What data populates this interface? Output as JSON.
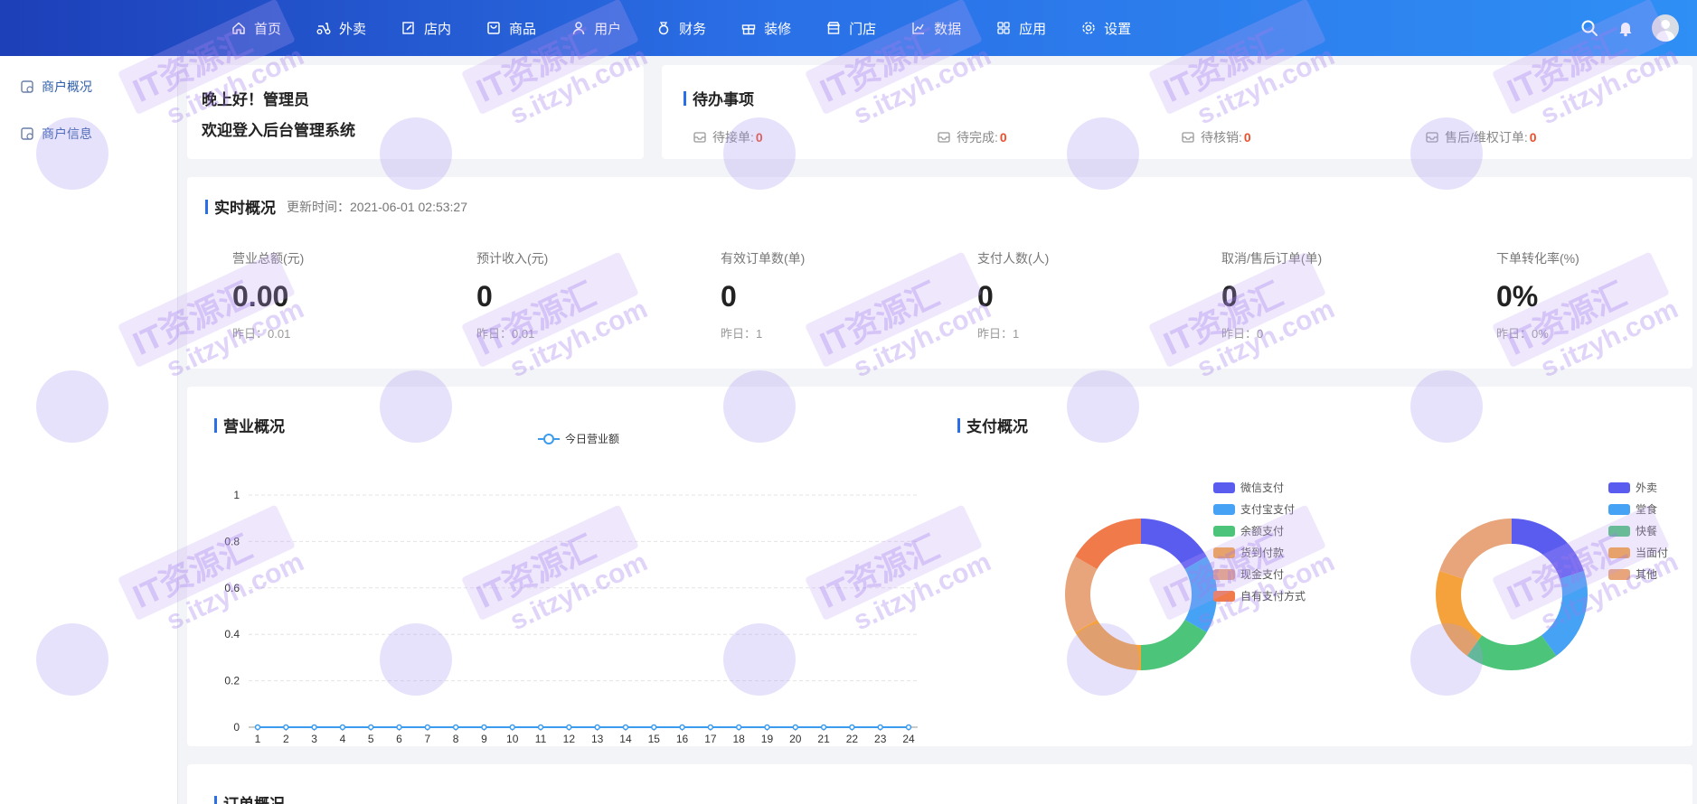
{
  "nav": [
    {
      "label": "首页",
      "icon": "home-icon"
    },
    {
      "label": "外卖",
      "icon": "scooter-icon"
    },
    {
      "label": "店内",
      "icon": "edit-icon"
    },
    {
      "label": "商品",
      "icon": "bag-icon"
    },
    {
      "label": "用户",
      "icon": "user-icon"
    },
    {
      "label": "财务",
      "icon": "money-bag-icon"
    },
    {
      "label": "装修",
      "icon": "gift-icon"
    },
    {
      "label": "门店",
      "icon": "store-icon"
    },
    {
      "label": "数据",
      "icon": "chart-icon"
    },
    {
      "label": "应用",
      "icon": "apps-icon"
    },
    {
      "label": "设置",
      "icon": "gear-icon"
    }
  ],
  "sidebar": {
    "items": [
      {
        "label": "商户概况",
        "icon": "overview-icon"
      },
      {
        "label": "商户信息",
        "icon": "info-icon"
      }
    ]
  },
  "welcome": {
    "line1": "晚上好！管理员",
    "line2": "欢迎登入后台管理系统"
  },
  "todo": {
    "title": "待办事项",
    "items": [
      {
        "label": "待接单:",
        "count": "0"
      },
      {
        "label": "待完成:",
        "count": "0"
      },
      {
        "label": "待核销:",
        "count": "0"
      },
      {
        "label": "售后/维权订单:",
        "count": "0"
      }
    ]
  },
  "realtime": {
    "title": "实时概况",
    "updated": "更新时间：2021-06-01 02:53:27",
    "metrics": [
      {
        "label": "营业总额(元)",
        "value": "0.00",
        "yesterday": "昨日：0.01"
      },
      {
        "label": "预计收入(元)",
        "value": "0",
        "yesterday": "昨日：0.01"
      },
      {
        "label": "有效订单数(单)",
        "value": "0",
        "yesterday": "昨日：1"
      },
      {
        "label": "支付人数(人)",
        "value": "0",
        "yesterday": "昨日：1"
      },
      {
        "label": "取消/售后订单(单)",
        "value": "0",
        "yesterday": "昨日：0"
      },
      {
        "label": "下单转化率(%)",
        "value": "0%",
        "yesterday": "昨日：0%"
      }
    ]
  },
  "business": {
    "title": "营业概况"
  },
  "payment": {
    "title": "支付概况"
  },
  "orders": {
    "title": "订单概况"
  },
  "watermark": {
    "brand": "IT资源汇",
    "domain": "s.itzyh.com"
  },
  "colors": {
    "accent": "#2a6fe6",
    "alert": "#ee4e2b"
  },
  "chart_data": [
    {
      "type": "line",
      "title": "营业概况",
      "series": [
        {
          "name": "今日营业额",
          "values": [
            0,
            0,
            0,
            0,
            0,
            0,
            0,
            0,
            0,
            0,
            0,
            0,
            0,
            0,
            0,
            0,
            0,
            0,
            0,
            0,
            0,
            0,
            0,
            0
          ]
        }
      ],
      "x": [
        1,
        2,
        3,
        4,
        5,
        6,
        7,
        8,
        9,
        10,
        11,
        12,
        13,
        14,
        15,
        16,
        17,
        18,
        19,
        20,
        21,
        22,
        23,
        24
      ],
      "yticks": [
        0,
        0.2,
        0.4,
        0.6,
        0.8,
        1
      ],
      "ylim": [
        0,
        1
      ],
      "grid": true,
      "legend": "top-center"
    },
    {
      "type": "pie",
      "style": "donut",
      "labels": [
        "微信支付",
        "支付宝支付",
        "余额支付",
        "货到付款",
        "现金支付",
        "自有支付方式"
      ],
      "values": [
        1,
        1,
        1,
        1,
        1,
        1
      ],
      "colors": [
        "#5a5cf0",
        "#45a2f5",
        "#4cc47a",
        "#f5a23c",
        "#e8a47a",
        "#f17a4a"
      ],
      "legend": "right"
    },
    {
      "type": "pie",
      "style": "donut",
      "labels": [
        "外卖",
        "堂食",
        "快餐",
        "当面付",
        "其他"
      ],
      "values": [
        1,
        1,
        1,
        1,
        1
      ],
      "colors": [
        "#5a5cf0",
        "#45a2f5",
        "#4cc47a",
        "#f5a23c",
        "#e8a47a"
      ],
      "legend": "right"
    }
  ]
}
